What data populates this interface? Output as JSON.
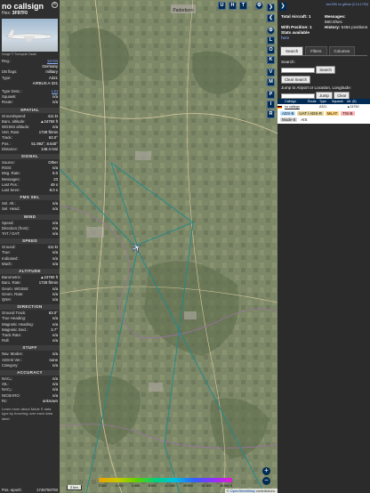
{
  "left": {
    "callsign": "no callsign",
    "hex_label": "Hex:",
    "hex_value": "3F97F0",
    "photo_credit": "Image © Tomoyuki Ozaki",
    "reg_rows": [
      {
        "k": "Reg.:",
        "v": "13+04",
        "link": true
      },
      {
        "k": "",
        "v": "Germany"
      },
      {
        "k": "DB flags:",
        "v": "military"
      },
      {
        "k": "Type:",
        "v": "A321"
      },
      {
        "k": "",
        "v": "AIRBUS A-321"
      }
    ],
    "type_rows": [
      {
        "k": "Type Desc.:",
        "v": "L2J",
        "link": true
      },
      {
        "k": "Squawk:",
        "v": "n/a"
      },
      {
        "k": "Route:",
        "v": "n/a"
      }
    ],
    "sections": [
      {
        "title": "SPATIAL",
        "rows": [
          {
            "k": "Groundspeed:",
            "v": "411 kt"
          },
          {
            "k": "Baro. altitude:",
            "v": "▲24750 ft"
          },
          {
            "k": "WGS84 altitude:",
            "v": "n/a"
          },
          {
            "k": "Vert. Rate:",
            "v": "1728 ft/min"
          },
          {
            "k": "Track:",
            "v": "63.0°"
          },
          {
            "k": "Pos.:",
            "v": "51.992°, 8.640°"
          },
          {
            "k": "Distance:",
            "v": "148.4 nmi"
          }
        ]
      },
      {
        "title": "SIGNAL",
        "rows": [
          {
            "k": "Source:",
            "v": "Other"
          },
          {
            "k": "RSSI:",
            "v": "n/a"
          },
          {
            "k": "Msg. Rate:",
            "v": "0.0"
          },
          {
            "k": "Messages:",
            "v": "23"
          },
          {
            "k": "Last Pos.:",
            "v": "49 s"
          },
          {
            "k": "Last Seen:",
            "v": "8.0 s"
          }
        ]
      },
      {
        "title": "FMS SEL",
        "rows": [
          {
            "k": "Sel. Alt.:",
            "v": "n/a"
          },
          {
            "k": "Sel. Head.:",
            "v": "n/a"
          }
        ]
      },
      {
        "title": "WIND",
        "rows": [
          {
            "k": "Speed:",
            "v": "n/a"
          },
          {
            "k": "Direction (from):",
            "v": "n/a"
          },
          {
            "k": "TAT / OAT:",
            "v": "n/a"
          }
        ]
      },
      {
        "title": "SPEED",
        "rows": [
          {
            "k": "Ground:",
            "v": "411 kt"
          },
          {
            "k": "True:",
            "v": "n/a"
          },
          {
            "k": "Indicated:",
            "v": "n/a"
          },
          {
            "k": "Mach:",
            "v": "n/a"
          }
        ]
      },
      {
        "title": "ALTITUDE",
        "rows": [
          {
            "k": "Barometric:",
            "v": "▲24750 ft"
          },
          {
            "k": "Baro. Rate:",
            "v": "1728 ft/min"
          },
          {
            "k": "Geom. WGS84:",
            "v": "n/a"
          },
          {
            "k": "Geom. Rate:",
            "v": "n/a"
          },
          {
            "k": "QNH:",
            "v": "n/a"
          }
        ]
      },
      {
        "title": "DIRECTION",
        "rows": [
          {
            "k": "Ground Track:",
            "v": "63.0°"
          },
          {
            "k": "True Heading:",
            "v": "n/a"
          },
          {
            "k": "Magnetic Heading:",
            "v": "n/a"
          },
          {
            "k": "Magnetic Decl.:",
            "v": "3.7°"
          },
          {
            "k": "Track Rate:",
            "v": "n/a"
          },
          {
            "k": "Roll:",
            "v": "n/a"
          }
        ]
      },
      {
        "title": "STUFF",
        "rows": [
          {
            "k": "Nav. Modes:",
            "v": "n/a"
          },
          {
            "k": "ADS-B Ver.:",
            "v": "none"
          },
          {
            "k": "Category:",
            "v": "n/a"
          }
        ]
      },
      {
        "title": "ACCURACY",
        "rows": [
          {
            "k": "NACₚ:",
            "v": "n/a"
          },
          {
            "k": "SIL:",
            "v": "n/a"
          },
          {
            "k": "NACᵥ:",
            "v": "n/a"
          },
          {
            "k": "NICBARO:",
            "v": "n/a"
          },
          {
            "k": "Rc:",
            "v": "unknown"
          }
        ]
      }
    ],
    "footnote": "Learn more about Mode S data type by hovering over each data label.",
    "pos_epoch_label": "Pos. epoch:",
    "pos_epoch_value": "1746758793"
  },
  "map": {
    "top_buttons": [
      "U",
      "H",
      "T"
    ],
    "side_buttons": [
      "L",
      "O",
      "K",
      "V",
      "M",
      "P",
      "I",
      "R"
    ],
    "zoom_in": "+",
    "zoom_out": "−",
    "scale_label": "2 km",
    "attribution_prefix": "© ",
    "attribution_link": "OpenStreetMap",
    "attribution_suffix": " contributors.",
    "alt_ticks": [
      "2 000",
      "4 000",
      "6 000",
      "8 000",
      "10 000",
      "20 000",
      "30 000",
      "40 000 ft"
    ],
    "place_top": "Paderborn"
  },
  "right": {
    "github": "tar1090 on github (3.14.1700)",
    "total_label": "Total Aircraft:",
    "total_value": "1",
    "messages_label": "Messages:",
    "messages_value": "560.0/sec",
    "withpos_label": "With Position:",
    "withpos_value": "1",
    "history_label": "History:",
    "history_value": "5494 positions",
    "stats_label": "Stats available",
    "stats_link": "here",
    "tabs": [
      "Search",
      "Filters",
      "Columns"
    ],
    "search_label": "Search:",
    "search_button": "Search",
    "clear_search": "Clear Search",
    "jump_label": "Jump to Airport or Location, Longitude:",
    "jump_button": "Jump",
    "clear_button": "Clear",
    "table_headers": [
      "",
      "Callsign",
      "Route",
      "Type",
      "Squawk",
      "Alt. (ft)"
    ],
    "table_row": {
      "callsign": "no callsign",
      "type": "A321",
      "alt": "▲24750"
    },
    "badges": [
      {
        "label": "ADS-B",
        "color": "#b8e0ff"
      },
      {
        "label": "UAT / ADS-R",
        "color": "#e6d49a"
      },
      {
        "label": "MLAT",
        "color": "#ffd27a"
      },
      {
        "label": "TIS-B",
        "color": "#ffb3b3"
      },
      {
        "label": "Mode-S",
        "color": "#d8d8d8"
      },
      {
        "label": "AIS",
        "color": "#ffffff"
      }
    ]
  },
  "colors": {
    "accent": "#002b55",
    "panel": "#2f2f2f",
    "track": "#1a8a8f"
  }
}
